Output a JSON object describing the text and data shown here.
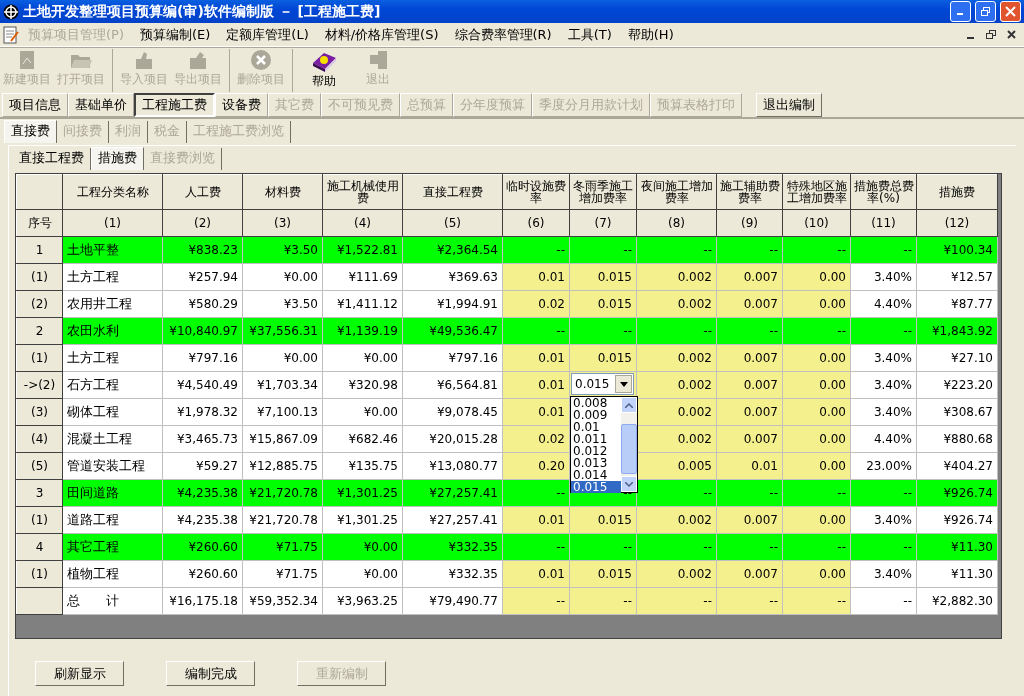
{
  "window": {
    "title": "土地开发整理项目预算编(审)软件编制版 － [工程施工费]"
  },
  "menu": [
    {
      "label": "预算项目管理(P)",
      "disabled": true
    },
    {
      "label": "预算编制(E)",
      "disabled": false
    },
    {
      "label": "定额库管理(L)",
      "disabled": false
    },
    {
      "label": "材料/价格库管理(S)",
      "disabled": false
    },
    {
      "label": "综合费率管理(R)",
      "disabled": false
    },
    {
      "label": "工具(T)",
      "disabled": false
    },
    {
      "label": "帮助(H)",
      "disabled": false
    }
  ],
  "toolbar": [
    {
      "kind": "new",
      "label": "新建项目",
      "disabled": true,
      "separator_after": false
    },
    {
      "kind": "open",
      "label": "打开项目",
      "disabled": true,
      "separator_after": true
    },
    {
      "kind": "import",
      "label": "导入项目",
      "disabled": true,
      "separator_after": false
    },
    {
      "kind": "export",
      "label": "导出项目",
      "disabled": true,
      "separator_after": true
    },
    {
      "kind": "delete",
      "label": "删除项目",
      "disabled": true,
      "separator_after": true
    },
    {
      "kind": "help",
      "label": "帮助",
      "disabled": false,
      "separator_after": false
    },
    {
      "kind": "exit",
      "label": "退出",
      "disabled": true,
      "separator_after": false
    }
  ],
  "nav": [
    {
      "label": "项目信息",
      "selected": false,
      "disabled": false
    },
    {
      "label": "基础单价",
      "selected": false,
      "disabled": false
    },
    {
      "label": "工程施工费",
      "selected": true,
      "disabled": false
    },
    {
      "label": "设备费",
      "selected": false,
      "disabled": false
    },
    {
      "label": "其它费",
      "selected": false,
      "disabled": true
    },
    {
      "label": "不可预见费",
      "selected": false,
      "disabled": true
    },
    {
      "label": "总预算",
      "selected": false,
      "disabled": true
    },
    {
      "label": "分年度预算",
      "selected": false,
      "disabled": true
    },
    {
      "label": "季度分月用款计划",
      "selected": false,
      "disabled": true
    },
    {
      "label": "预算表格打印",
      "selected": false,
      "disabled": true
    }
  ],
  "exit_button": "退出编制",
  "tabs": [
    {
      "label": "直接费",
      "selected": true,
      "disabled": false
    },
    {
      "label": "间接费",
      "selected": false,
      "disabled": true
    },
    {
      "label": "利润",
      "selected": false,
      "disabled": true
    },
    {
      "label": "税金",
      "selected": false,
      "disabled": true
    },
    {
      "label": "工程施工费浏览",
      "selected": false,
      "disabled": true
    }
  ],
  "subtabs": [
    {
      "label": "直接工程费",
      "selected": false,
      "disabled": false
    },
    {
      "label": "措施费",
      "selected": true,
      "disabled": false
    },
    {
      "label": "直接费浏览",
      "selected": false,
      "disabled": true
    }
  ],
  "table": {
    "header_titles": [
      "工程分类名称",
      "人工费",
      "材料费",
      "施工机械使用费",
      "直接工程费",
      "临时设施费率",
      "冬雨季施工增加费率",
      "夜间施工增加费率",
      "施工辅助费费率",
      "特殊地区施工增加费率",
      "措施费总费率(%)",
      "措施费"
    ],
    "header_numbers": [
      "序号",
      "(1)",
      "(2)",
      "(3)",
      "(4)",
      "(5)",
      "(6)",
      "(7)",
      "(8)",
      "(9)",
      "(10)",
      "(11)",
      "(12)"
    ],
    "rows": [
      {
        "kind": "group",
        "seq": "1",
        "cells": [
          "土地平整",
          "¥838.23",
          "¥3.50",
          "¥1,522.81",
          "¥2,364.54",
          "--",
          "--",
          "--",
          "--",
          "--",
          "--",
          "¥100.34"
        ]
      },
      {
        "kind": "item",
        "seq": "(1)",
        "cells": [
          "土方工程",
          "¥257.94",
          "¥0.00",
          "¥111.69",
          "¥369.63",
          "0.01",
          "0.015",
          "0.002",
          "0.007",
          "0.00",
          "3.40%",
          "¥12.57"
        ]
      },
      {
        "kind": "item",
        "seq": "(2)",
        "cells": [
          "农用井工程",
          "¥580.29",
          "¥3.50",
          "¥1,411.12",
          "¥1,994.91",
          "0.02",
          "0.015",
          "0.002",
          "0.007",
          "0.00",
          "4.40%",
          "¥87.77"
        ]
      },
      {
        "kind": "group",
        "seq": "2",
        "cells": [
          "农田水利",
          "¥10,840.97",
          "¥37,556.31",
          "¥1,139.19",
          "¥49,536.47",
          "--",
          "--",
          "--",
          "--",
          "--",
          "--",
          "¥1,843.92"
        ]
      },
      {
        "kind": "item",
        "seq": "(1)",
        "cells": [
          "土方工程",
          "¥797.16",
          "¥0.00",
          "¥0.00",
          "¥797.16",
          "0.01",
          "0.015",
          "0.002",
          "0.007",
          "0.00",
          "3.40%",
          "¥27.10"
        ]
      },
      {
        "kind": "item",
        "seq": "->(2)",
        "cells": [
          "石方工程",
          "¥4,540.49",
          "¥1,703.34",
          "¥320.98",
          "¥6,564.81",
          "0.01",
          null,
          "0.002",
          "0.007",
          "0.00",
          "3.40%",
          "¥223.20"
        ],
        "editor": {
          "value": "0.015",
          "options": [
            {
              "label": "0.008",
              "selected": false
            },
            {
              "label": "0.009",
              "selected": false
            },
            {
              "label": "0.01",
              "selected": false
            },
            {
              "label": "0.011",
              "selected": false
            },
            {
              "label": "0.012",
              "selected": false
            },
            {
              "label": "0.013",
              "selected": false
            },
            {
              "label": "0.014",
              "selected": false
            },
            {
              "label": "0.015",
              "selected": true
            }
          ]
        }
      },
      {
        "kind": "item",
        "seq": "(3)",
        "cells": [
          "砌体工程",
          "¥1,978.32",
          "¥7,100.13",
          "¥0.00",
          "¥9,078.45",
          "0.01",
          null,
          "0.002",
          "0.007",
          "0.00",
          "3.40%",
          "¥308.67"
        ]
      },
      {
        "kind": "item",
        "seq": "(4)",
        "cells": [
          "混凝土工程",
          "¥3,465.73",
          "¥15,867.09",
          "¥682.46",
          "¥20,015.28",
          "0.02",
          null,
          "0.002",
          "0.007",
          "0.00",
          "4.40%",
          "¥880.68"
        ]
      },
      {
        "kind": "item",
        "seq": "(5)",
        "cells": [
          "管道安装工程",
          "¥59.27",
          "¥12,885.75",
          "¥135.75",
          "¥13,080.77",
          "0.20",
          null,
          "0.005",
          "0.01",
          "0.00",
          "23.00%",
          "¥404.27"
        ]
      },
      {
        "kind": "group",
        "seq": "3",
        "cells": [
          "田间道路",
          "¥4,235.38",
          "¥21,720.78",
          "¥1,301.25",
          "¥27,257.41",
          "--",
          "--",
          "--",
          "--",
          "--",
          "--",
          "¥926.74"
        ]
      },
      {
        "kind": "item",
        "seq": "(1)",
        "cells": [
          "道路工程",
          "¥4,235.38",
          "¥21,720.78",
          "¥1,301.25",
          "¥27,257.41",
          "0.01",
          "0.015",
          "0.002",
          "0.007",
          "0.00",
          "3.40%",
          "¥926.74"
        ]
      },
      {
        "kind": "group",
        "seq": "4",
        "cells": [
          "其它工程",
          "¥260.60",
          "¥71.75",
          "¥0.00",
          "¥332.35",
          "--",
          "--",
          "--",
          "--",
          "--",
          "--",
          "¥11.30"
        ]
      },
      {
        "kind": "item",
        "seq": "(1)",
        "cells": [
          "植物工程",
          "¥260.60",
          "¥71.75",
          "¥0.00",
          "¥332.35",
          "0.01",
          "0.015",
          "0.002",
          "0.007",
          "0.00",
          "3.40%",
          "¥11.30"
        ]
      },
      {
        "kind": "total",
        "seq": null,
        "cells": [
          "总　　计",
          "¥16,175.18",
          "¥59,352.34",
          "¥3,963.25",
          "¥79,490.77",
          "--",
          "--",
          "--",
          "--",
          "--",
          "--",
          "¥2,882.30"
        ]
      }
    ]
  },
  "bottom_buttons": [
    {
      "label": "刷新显示",
      "disabled": false
    },
    {
      "label": "编制完成",
      "disabled": false
    },
    {
      "label": "重新编制",
      "disabled": true
    }
  ]
}
